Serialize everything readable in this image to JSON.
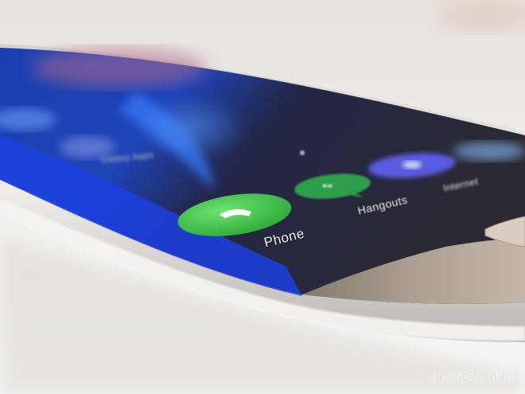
{
  "photo": {
    "subject": "curved-edge smartphone home screen",
    "colors": {
      "background": "#efedeb",
      "screen_blue": "#1e44b8",
      "screen_dark": "#1b1d2e",
      "phone_green": "#3fbf4a",
      "hangouts_green": "#2f9e4b",
      "internet_purple": "#5a5be0",
      "frame_silver": "#c9c6c1",
      "bezel_gold": "#b8a99a"
    }
  },
  "apps": [
    {
      "label": "Phone",
      "icon": "phone-icon"
    },
    {
      "label": "Hangouts",
      "icon": "hangouts-icon"
    },
    {
      "label": "Internet",
      "icon": "internet-icon"
    }
  ],
  "blurred_label": "Galaxy Apps",
  "watermark": "androidcentral"
}
